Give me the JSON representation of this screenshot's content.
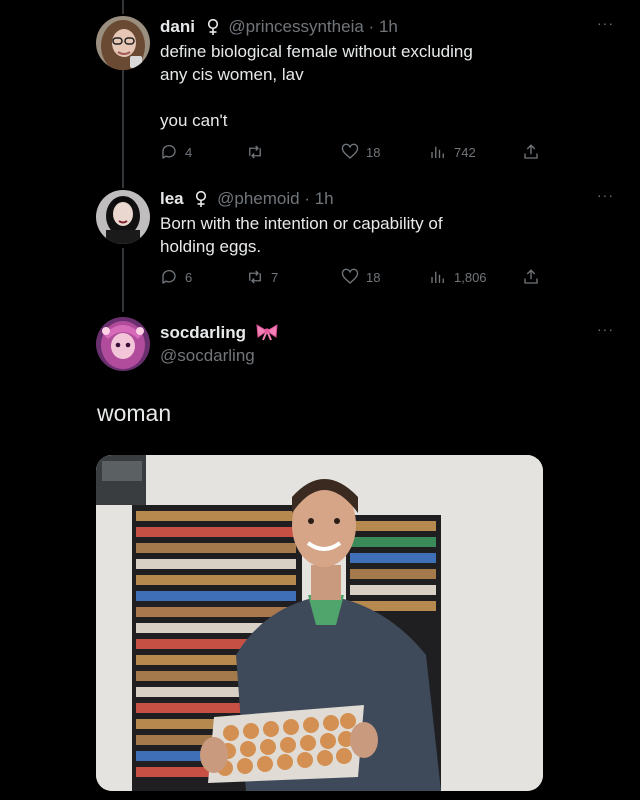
{
  "tweets": [
    {
      "name": "dani",
      "handle": "@princessyntheia",
      "separator": "·",
      "time": "1h",
      "text_lines": [
        "define biological female without excluding",
        "any cis women, lav",
        "",
        "you can't"
      ],
      "stats": {
        "replies": "4",
        "retweets": "",
        "likes": "18",
        "views": "742"
      }
    },
    {
      "name": "lea",
      "handle": "@phemoid",
      "separator": "·",
      "time": "1h",
      "text_lines": [
        "Born with the intention or capability of",
        "holding eggs."
      ],
      "stats": {
        "replies": "6",
        "retweets": "7",
        "likes": "18",
        "views": "1,806"
      }
    }
  ],
  "quote_user": {
    "name": "socdarling",
    "handle": "@socdarling"
  },
  "caption": "woman",
  "more_glyph": "···",
  "icons": {
    "gender": "female-symbol-icon",
    "reply": "reply-icon",
    "retweet": "retweet-icon",
    "like": "heart-icon",
    "views": "views-chart-icon",
    "share": "share-icon",
    "badge": "pink-bow-icon"
  },
  "colors": {
    "background": "#000000",
    "text": "#e7e9ea",
    "muted": "#71767b",
    "divider": "#333639",
    "bow": "#f47fb4"
  }
}
